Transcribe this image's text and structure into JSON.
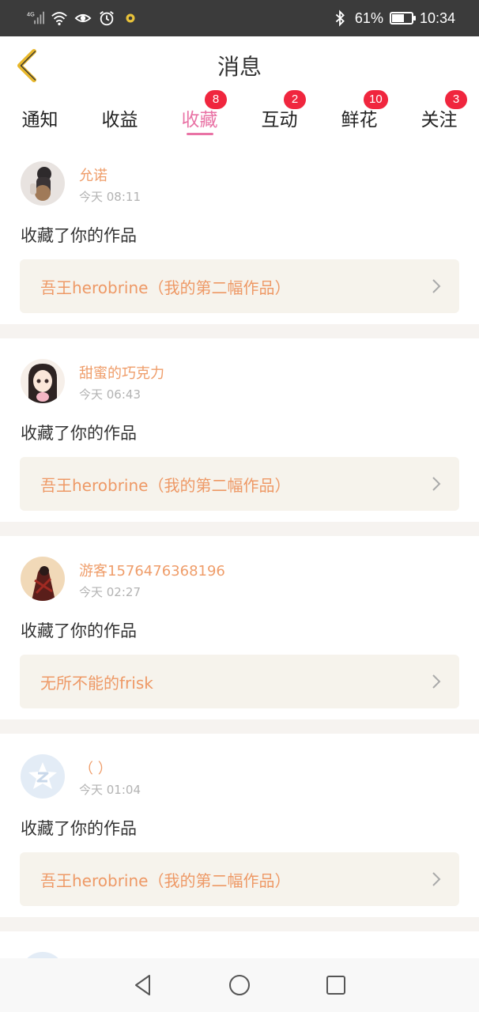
{
  "status_bar": {
    "network": "4G",
    "battery_percent": "61%",
    "battery_level": 0.61,
    "time": "10:34"
  },
  "header": {
    "title": "消息"
  },
  "tabs": [
    {
      "label": "通知",
      "badge": ""
    },
    {
      "label": "收益",
      "badge": ""
    },
    {
      "label": "收藏",
      "badge": "8",
      "active": true
    },
    {
      "label": "互动",
      "badge": "2"
    },
    {
      "label": "鲜花",
      "badge": "10"
    },
    {
      "label": "关注",
      "badge": "3"
    }
  ],
  "messages": [
    {
      "user": "允诺",
      "time": "今天 08:11",
      "action": "收藏了你的作品",
      "work": "吾王herobrine（我的第二幅作品）",
      "avatar": "avatar-girl-backpack"
    },
    {
      "user": "甜蜜的巧克力",
      "time": "今天 06:43",
      "action": "收藏了你的作品",
      "work": "吾王herobrine（我的第二幅作品）",
      "avatar": "avatar-anime-girl"
    },
    {
      "user": "游客1576476368196",
      "time": "今天 02:27",
      "action": "收藏了你的作品",
      "work": "无所不能的frisk",
      "avatar": "avatar-dark-figure"
    },
    {
      "user": "（  ）",
      "time": "今天 01:04",
      "action": "收藏了你的作品",
      "work": "吾王herobrine（我的第二幅作品）",
      "avatar": "avatar-qq-default"
    }
  ],
  "colors": {
    "accent": "#e973a5",
    "badge": "#f0263e",
    "username": "#ef9d6a",
    "work_box": "#f6f3ec",
    "back_arrow": "#e8b72a"
  }
}
